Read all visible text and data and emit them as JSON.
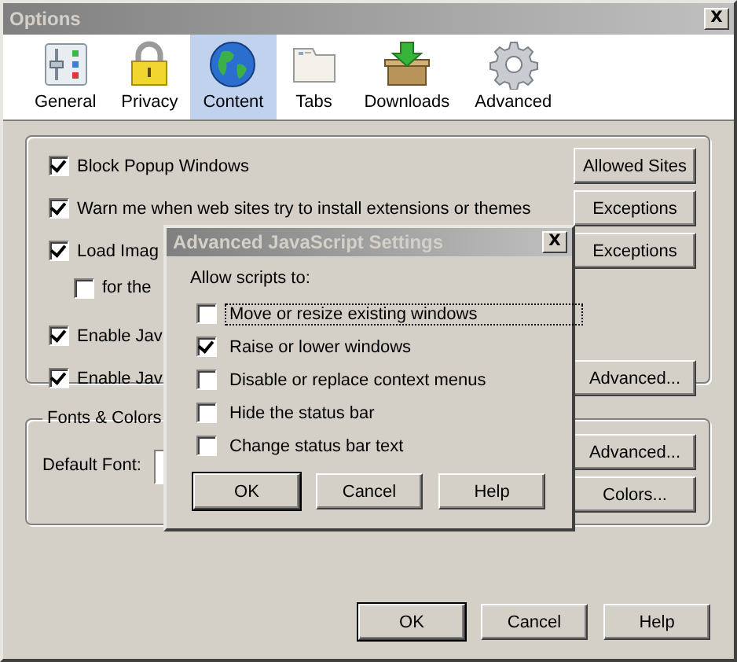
{
  "window": {
    "title": "Options",
    "close": "X"
  },
  "toolbar": [
    {
      "kind": "general",
      "label": "General",
      "selected": false
    },
    {
      "kind": "privacy",
      "label": "Privacy",
      "selected": false
    },
    {
      "kind": "content",
      "label": "Content",
      "selected": true
    },
    {
      "kind": "tabs",
      "label": "Tabs",
      "selected": false
    },
    {
      "kind": "downloads",
      "label": "Downloads",
      "selected": false
    },
    {
      "kind": "advanced",
      "label": "Advanced",
      "selected": false
    }
  ],
  "content_group": {
    "rows": [
      {
        "label": "Block Popup Windows",
        "checked": true,
        "button": "Allowed Sites"
      },
      {
        "label": "Warn me when web sites try to install extensions or themes",
        "checked": true,
        "button": "Exceptions"
      },
      {
        "label": "Load Imag",
        "checked": true,
        "button": "Exceptions",
        "children": [
          {
            "label": "for the",
            "checked": false
          }
        ]
      },
      {
        "label": "Enable Jav",
        "checked": true
      },
      {
        "label": "Enable Jav",
        "checked": true,
        "button": "Advanced..."
      }
    ]
  },
  "fonts_group": {
    "title": "Fonts & Colors",
    "default_font_label": "Default Font:",
    "buttons": [
      "Advanced...",
      "Colors..."
    ]
  },
  "buttons": [
    "OK",
    "Cancel",
    "Help"
  ],
  "dialog": {
    "title": "Advanced JavaScript Settings",
    "close": "X",
    "intro": "Allow scripts to:",
    "options": [
      {
        "label": "Move or resize existing windows",
        "checked": false,
        "focused": true
      },
      {
        "label": "Raise or lower windows",
        "checked": true,
        "focused": false
      },
      {
        "label": "Disable or replace context menus",
        "checked": false,
        "focused": false
      },
      {
        "label": "Hide the status bar",
        "checked": false,
        "focused": false
      },
      {
        "label": "Change status bar text",
        "checked": false,
        "focused": false
      }
    ],
    "buttons": [
      "OK",
      "Cancel",
      "Help"
    ]
  }
}
